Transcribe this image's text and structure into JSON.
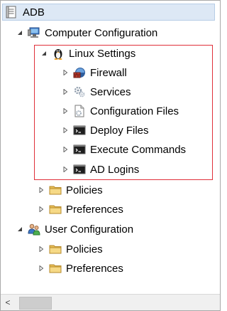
{
  "tree": {
    "root": {
      "label": "ADB"
    },
    "computer_config": {
      "label": "Computer Configuration"
    },
    "linux_settings": {
      "label": "Linux Settings"
    },
    "firewall": {
      "label": "Firewall"
    },
    "services": {
      "label": "Services"
    },
    "config_files": {
      "label": "Configuration Files"
    },
    "deploy_files": {
      "label": "Deploy Files"
    },
    "execute_commands": {
      "label": "Execute Commands"
    },
    "ad_logins": {
      "label": "AD Logins"
    },
    "cc_policies": {
      "label": "Policies"
    },
    "cc_preferences": {
      "label": "Preferences"
    },
    "user_config": {
      "label": "User Configuration"
    },
    "uc_policies": {
      "label": "Policies"
    },
    "uc_preferences": {
      "label": "Preferences"
    }
  },
  "scrollbar": {
    "left_arrow": "<"
  },
  "colors": {
    "selection_bg": "#dde8f5",
    "highlight_border": "#e0303a",
    "folder_yellow": "#f4d27a"
  }
}
